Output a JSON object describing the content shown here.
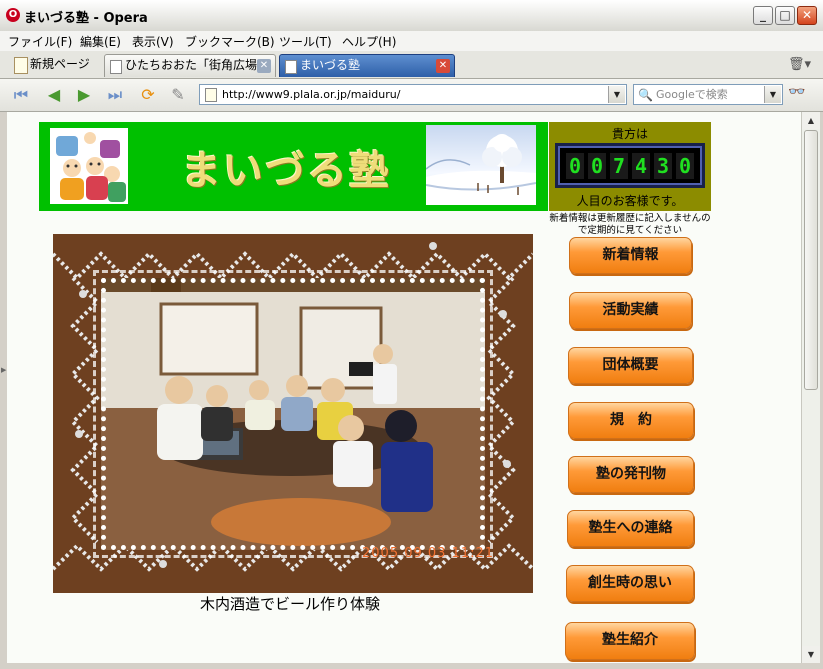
{
  "window": {
    "title": "まいづる塾 - Opera"
  },
  "menu": [
    "ファイル(F)",
    "編集(E)",
    "表示(V)",
    "ブックマーク(B)",
    "ツール(T)",
    "ヘルプ(H)"
  ],
  "tabs": {
    "new_page": "新規ページ",
    "tab1": "ひたちおおた「街角広場」",
    "tab2": "まいづる塾"
  },
  "address": {
    "url": "http://www9.plala.or.jp/maiduru/"
  },
  "search": {
    "placeholder": "Googleで検索"
  },
  "site": {
    "title": "まいづる塾",
    "counter_top": "貴方は",
    "counter_digits": [
      "0",
      "0",
      "7",
      "4",
      "3",
      "0"
    ],
    "counter_bottom": "人目のお客様です。",
    "notice": "新着情報は更新履歴に記入しませんので定期的に見てください",
    "photo_timestamp": "2005 09 03 11:21",
    "photo_caption": "木内酒造でビール作り体験",
    "nav": [
      "新着情報",
      "活動実績",
      "団体概要",
      "規　約",
      "塾の発刊物",
      "塾生への連絡",
      "創生時の思い",
      "塾生紹介"
    ]
  },
  "colors": {
    "banner_green": "#00c000",
    "counter_olive": "#8c8c00",
    "nav_orange": "#ff9a38",
    "counter_digit": "#20e020"
  }
}
